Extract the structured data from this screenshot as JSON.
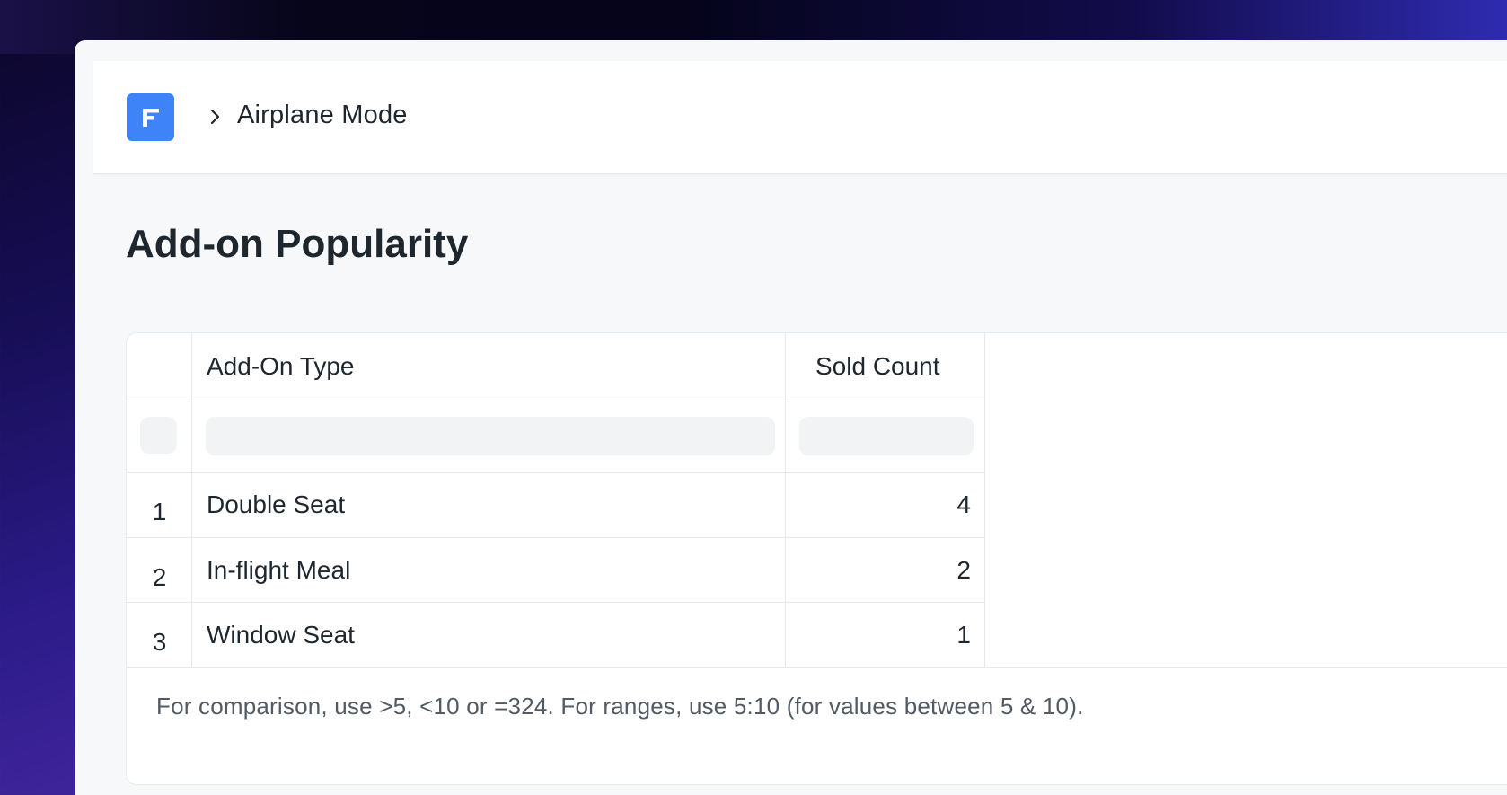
{
  "navbar": {
    "logo_icon": "frappe-logo-icon",
    "logo_color": "#3f83f8",
    "separator_icon": "chevron-right-icon",
    "breadcrumb_title": "Airplane Mode"
  },
  "page": {
    "title": "Add-on Popularity"
  },
  "report": {
    "columns": {
      "index": "",
      "type": "Add-On Type",
      "count": "Sold Count"
    },
    "rows": [
      {
        "index": "1",
        "type": "Double Seat",
        "count": "4"
      },
      {
        "index": "2",
        "type": "In-flight Meal",
        "count": "2"
      },
      {
        "index": "3",
        "type": "Window Seat",
        "count": "1"
      }
    ],
    "help_text": "For comparison, use >5, <10 or =324. For ranges, use 5:10 (for values between 5 & 10)."
  }
}
